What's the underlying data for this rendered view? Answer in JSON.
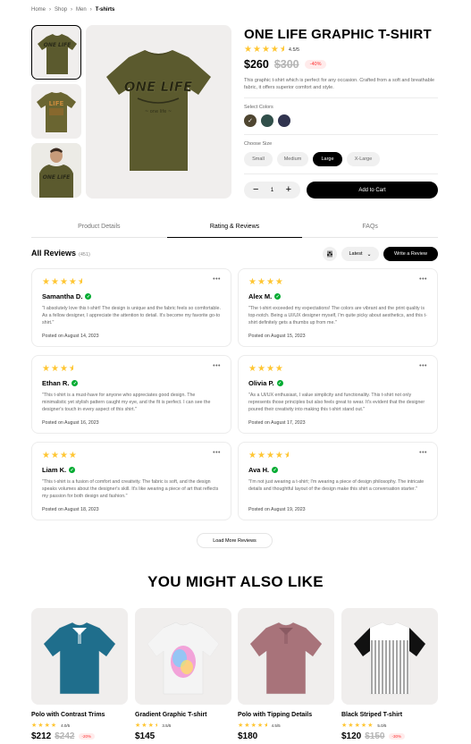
{
  "breadcrumb": [
    "Home",
    "Shop",
    "Men",
    "T-shirts"
  ],
  "product": {
    "title": "ONE LIFE GRAPHIC T-SHIRT",
    "rating": 4.5,
    "rating_text": "4.5/5",
    "price": "$260",
    "old_price": "$300",
    "discount": "-40%",
    "description": "This graphic t-shirt which is perfect for any occasion. Crafted from a soft and breathable fabric, it offers superior comfort and style.",
    "colors_label": "Select Colors",
    "colors": [
      "#4F4631",
      "#314F4A",
      "#31344F"
    ],
    "selected_color": 0,
    "size_label": "Choose Size",
    "sizes": [
      "Small",
      "Medium",
      "Large",
      "X-Large"
    ],
    "selected_size": 2,
    "quantity": "1",
    "qty_minus": "−",
    "qty_plus": "+",
    "add_to_cart": "Add to Cart"
  },
  "tabs": [
    "Product Details",
    "Rating & Reviews",
    "FAQs"
  ],
  "active_tab": 1,
  "reviews_section": {
    "title": "All Reviews",
    "count": "(451)",
    "sort_label": "Latest",
    "write_label": "Write a Review",
    "load_more": "Load More Reviews",
    "menu_glyph": "•••",
    "verified_glyph": "✓"
  },
  "reviews": [
    {
      "name": "Samantha D.",
      "rating": 4.5,
      "text": "\"I absolutely love this t-shirt! The design is unique and the fabric feels so comfortable. As a fellow designer, I appreciate the attention to detail. It's become my favorite go-to shirt.\"",
      "date": "Posted on August 14, 2023"
    },
    {
      "name": "Alex M.",
      "rating": 4,
      "text": "\"The t-shirt exceeded my expectations! The colors are vibrant and the print quality is top-notch. Being a UI/UX designer myself, I'm quite picky about aesthetics, and this t-shirt definitely gets a thumbs up from me.\"",
      "date": "Posted on August 15, 2023"
    },
    {
      "name": "Ethan R.",
      "rating": 3.5,
      "text": "\"This t-shirt is a must-have for anyone who appreciates good design. The minimalistic yet stylish pattern caught my eye, and the fit is perfect. I can see the designer's touch in every aspect of this shirt.\"",
      "date": "Posted on August 16, 2023"
    },
    {
      "name": "Olivia P.",
      "rating": 4,
      "text": "\"As a UI/UX enthusiast, I value simplicity and functionality. This t-shirt not only represents those principles but also feels great to wear. It's evident that the designer poured their creativity into making this t-shirt stand out.\"",
      "date": "Posted on August 17, 2023"
    },
    {
      "name": "Liam K.",
      "rating": 4,
      "text": "\"This t-shirt is a fusion of comfort and creativity. The fabric is soft, and the design speaks volumes about the designer's skill. It's like wearing a piece of art that reflects my passion for both design and fashion.\"",
      "date": "Posted on August 18, 2023"
    },
    {
      "name": "Ava H.",
      "rating": 4.5,
      "text": "\"I'm not just wearing a t-shirt; I'm wearing a piece of design philosophy. The intricate details and thoughtful layout of the design make this shirt a conversation starter.\"",
      "date": "Posted on August 19, 2023"
    }
  ],
  "you_might_also_like": {
    "title": "YOU MIGHT ALSO LIKE",
    "products": [
      {
        "name": "Polo with Contrast Trims",
        "rating": 4,
        "rating_text": "4.0/5",
        "price": "$212",
        "old_price": "$242",
        "discount": "-20%",
        "body_color": "#1f6e8c",
        "trim_color": "#ffffff"
      },
      {
        "name": "Gradient Graphic T-shirt",
        "rating": 3.5,
        "rating_text": "3.5/5",
        "price": "$145",
        "old_price": "",
        "discount": "",
        "body_color": "#f4f4f4",
        "trim_color": "#e0e0e0"
      },
      {
        "name": "Polo with Tipping Details",
        "rating": 4.5,
        "rating_text": "4.5/5",
        "price": "$180",
        "old_price": "",
        "discount": "",
        "body_color": "#a8737a",
        "trim_color": "#8a5a62"
      },
      {
        "name": "Black Striped T-shirt",
        "rating": 5,
        "rating_text": "5.0/5",
        "price": "$120",
        "old_price": "$150",
        "discount": "-30%",
        "body_color": "#ffffff",
        "trim_color": "#111111"
      }
    ]
  },
  "colors": {
    "star": "#FFC633",
    "verified": "#01AB31",
    "discount_text": "#FF3333",
    "discount_bg": "#FFEBEB",
    "main_shirt": "#5b5a2e"
  }
}
